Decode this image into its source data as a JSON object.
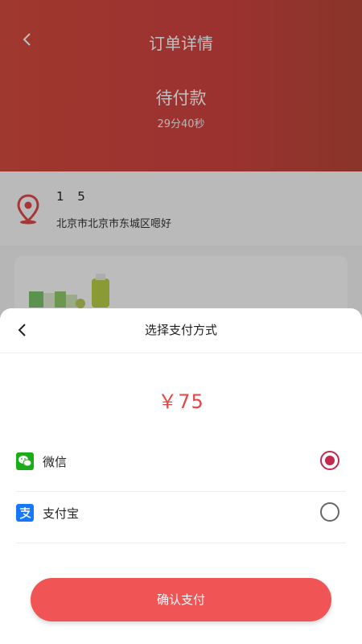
{
  "background_page": {
    "title": "订单详情",
    "status": "待付款",
    "countdown": "29分40秒",
    "address": {
      "name": "1 5",
      "text": "北京市北京市东城区嗯好"
    }
  },
  "payment_sheet": {
    "title": "选择支付方式",
    "amount": "￥75",
    "methods": [
      {
        "label": "微信",
        "icon": "wechat-icon",
        "selected": true,
        "color": "#1AAD19"
      },
      {
        "label": "支付宝",
        "icon": "alipay-icon",
        "selected": false,
        "color": "#1677FF"
      }
    ],
    "confirm_label": "确认支付"
  },
  "colors": {
    "header": "#d04340",
    "accent": "#f05454",
    "amount": "#e54545",
    "radio_selected": "#c22a4e"
  }
}
